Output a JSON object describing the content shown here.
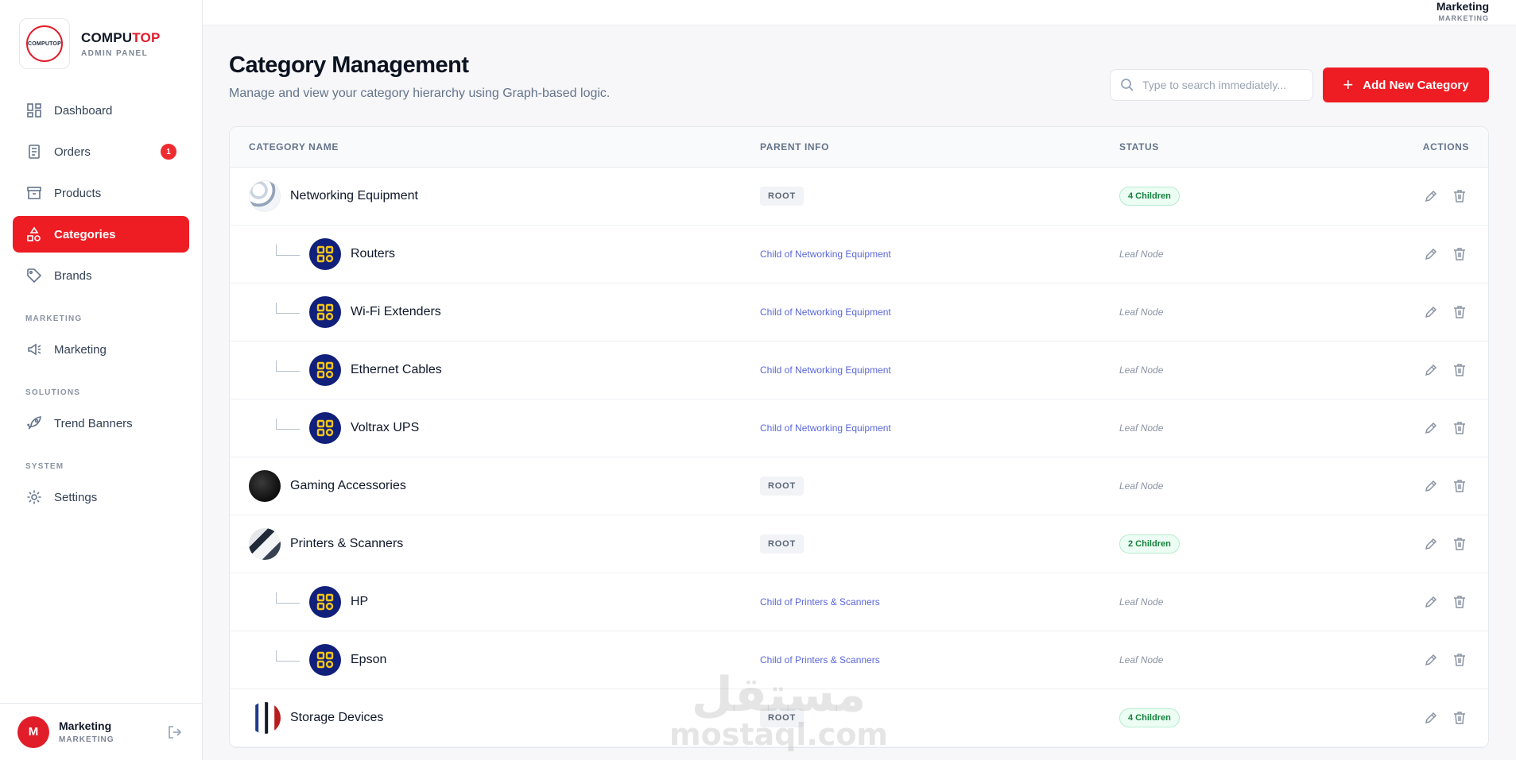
{
  "brand": {
    "logo_text": "COMPUTOP",
    "name_part1": "COMPU",
    "name_part2": "TOP",
    "subtitle": "ADMIN PANEL"
  },
  "sidebar": {
    "items": [
      {
        "label": "Dashboard",
        "icon": "dashboard-icon"
      },
      {
        "label": "Orders",
        "icon": "orders-icon",
        "badge": "1"
      },
      {
        "label": "Products",
        "icon": "box-icon"
      },
      {
        "label": "Categories",
        "icon": "shapes-icon",
        "active": true
      },
      {
        "label": "Brands",
        "icon": "tag-icon"
      }
    ],
    "sections": [
      {
        "title": "MARKETING",
        "items": [
          {
            "label": "Marketing",
            "icon": "megaphone-icon"
          }
        ]
      },
      {
        "title": "SOLUTIONS",
        "items": [
          {
            "label": "Trend Banners",
            "icon": "rocket-icon"
          }
        ]
      },
      {
        "title": "SYSTEM",
        "items": [
          {
            "label": "Settings",
            "icon": "gear-icon"
          }
        ]
      }
    ]
  },
  "user": {
    "initial": "M",
    "name": "Marketing",
    "role": "MARKETING"
  },
  "topbar": {
    "name": "Marketing",
    "role": "MARKETING"
  },
  "page": {
    "title": "Category Management",
    "subtitle": "Manage and view your category hierarchy using Graph-based logic.",
    "search_placeholder": "Type to search immediately...",
    "add_button": "Add New Category"
  },
  "table": {
    "headers": {
      "name": "CATEGORY NAME",
      "parent": "PARENT INFO",
      "status": "STATUS",
      "actions": "ACTIONS"
    },
    "rows": [
      {
        "name": "Networking Equipment",
        "parent": "ROOT",
        "status": "4 Children"
      },
      {
        "name": "Routers",
        "parent": "Child of Networking Equipment",
        "status": "Leaf Node"
      },
      {
        "name": "Wi-Fi Extenders",
        "parent": "Child of Networking Equipment",
        "status": "Leaf Node"
      },
      {
        "name": "Ethernet Cables",
        "parent": "Child of Networking Equipment",
        "status": "Leaf Node"
      },
      {
        "name": "Voltrax UPS",
        "parent": "Child of Networking Equipment",
        "status": "Leaf Node"
      },
      {
        "name": "Gaming Accessories",
        "parent": "ROOT",
        "status": "Leaf Node"
      },
      {
        "name": "Printers & Scanners",
        "parent": "ROOT",
        "status": "2 Children"
      },
      {
        "name": "HP",
        "parent": "Child of Printers & Scanners",
        "status": "Leaf Node"
      },
      {
        "name": "Epson",
        "parent": "Child of Printers & Scanners",
        "status": "Leaf Node"
      },
      {
        "name": "Storage Devices",
        "parent": "ROOT",
        "status": "4 Children"
      }
    ]
  },
  "watermark": {
    "arabic": "مستقل",
    "latin": "mostaql.com"
  },
  "colors": {
    "accent": "#ee1d24",
    "badge_green": "#15803d",
    "link": "#5a67d8",
    "category_icon_bg": "#11207a",
    "category_icon_fg": "#f5c518"
  }
}
